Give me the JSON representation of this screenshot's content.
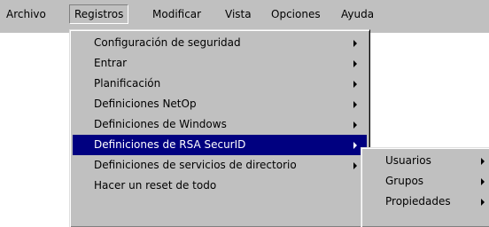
{
  "menubar": {
    "items": [
      "Archivo",
      "Registros",
      "Modificar",
      "Vista",
      "Opciones",
      "Ayuda"
    ],
    "open_item": "Registros"
  },
  "registros_menu": {
    "items": [
      {
        "label": "Configuración de seguridad",
        "has_submenu": true
      },
      {
        "label": "Entrar",
        "has_submenu": true
      },
      {
        "label": "Planificación",
        "has_submenu": true
      },
      {
        "label": "Definiciones NetOp",
        "has_submenu": true
      },
      {
        "label": "Definiciones de Windows",
        "has_submenu": true
      },
      {
        "label": "Definiciones de RSA SecurID",
        "has_submenu": true,
        "highlighted": true
      },
      {
        "label": "Definiciones de servicios de directorio",
        "has_submenu": true
      },
      {
        "label": "Hacer un reset de todo",
        "has_submenu": false
      }
    ]
  },
  "securid_submenu": {
    "items": [
      {
        "label": "Usuarios",
        "has_submenu": true
      },
      {
        "label": "Grupos",
        "has_submenu": true
      },
      {
        "label": "Propiedades",
        "has_submenu": true
      }
    ]
  },
  "colors": {
    "menu_background": "#c0c0c0",
    "highlight_background": "#000080",
    "highlight_text": "#ffffff"
  },
  "icons": {
    "submenu_indicator": "triangle-right-icon"
  }
}
